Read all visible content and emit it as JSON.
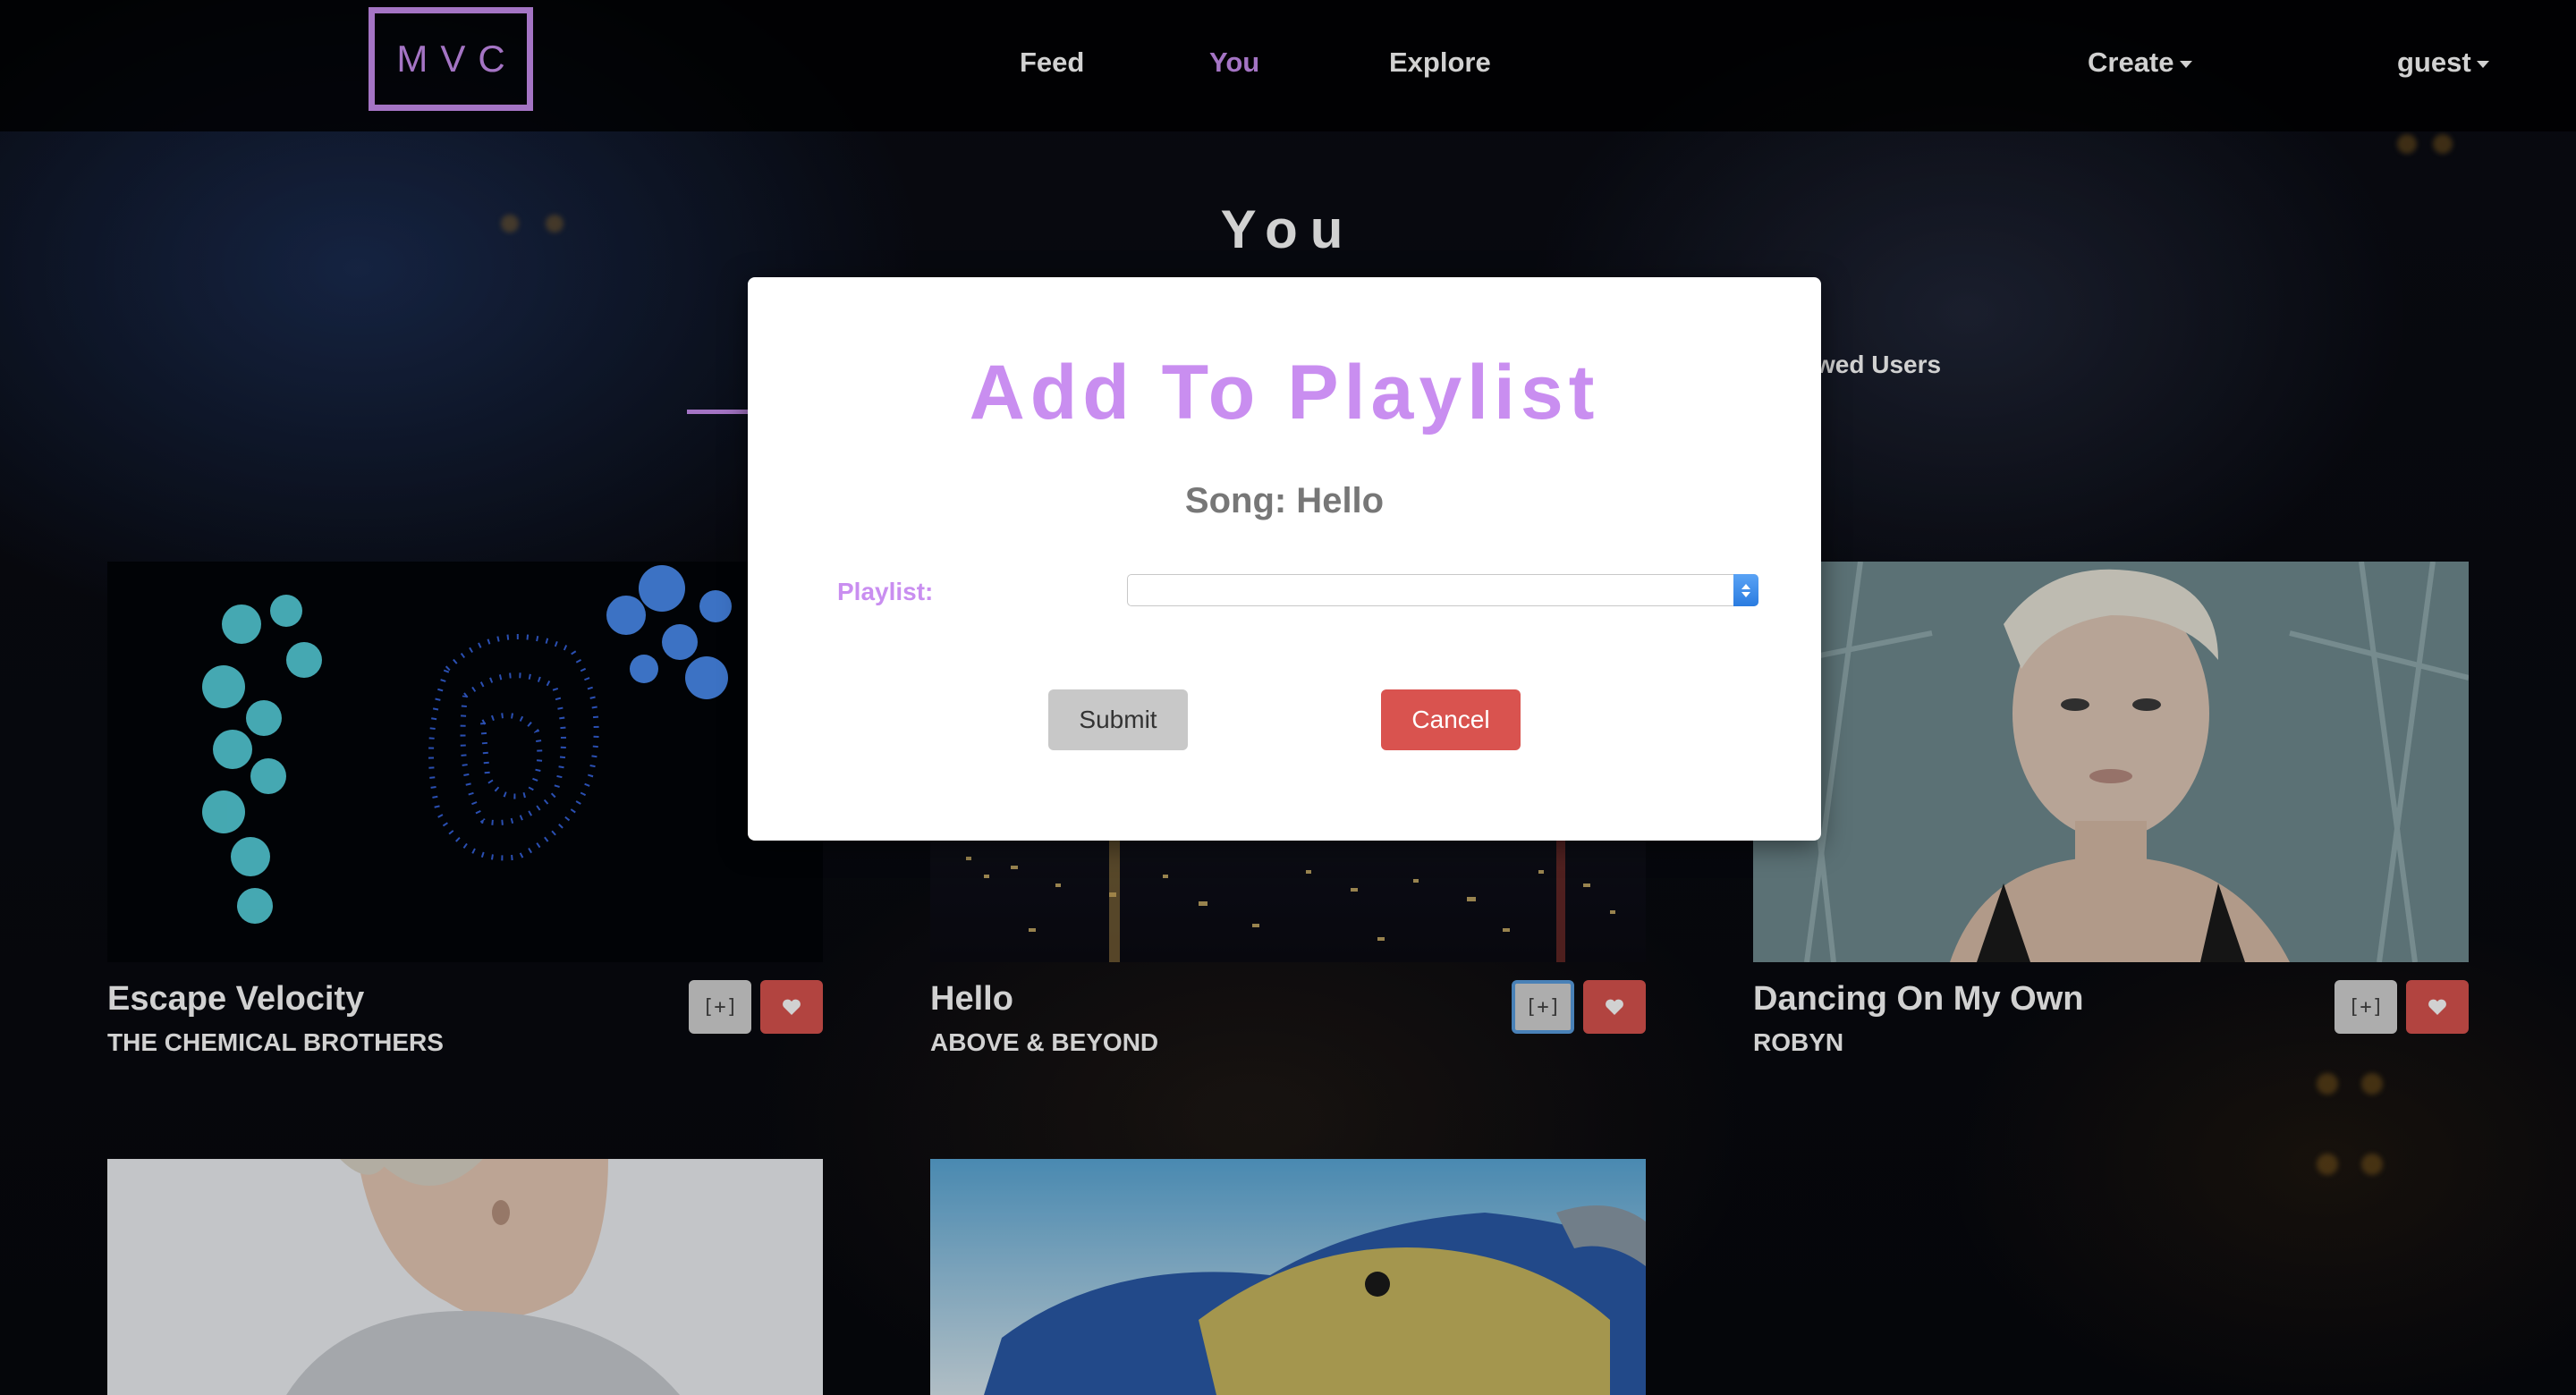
{
  "nav": {
    "logo": "MVC",
    "links": [
      "Feed",
      "You",
      "Explore"
    ],
    "active": "You",
    "create": "Create",
    "user": "guest"
  },
  "page": {
    "title": "You",
    "tab_fragment": "wed Users"
  },
  "songs": [
    {
      "title": "Escape Velocity",
      "artist": "THE CHEMICAL BROTHERS",
      "add_label": "[+]"
    },
    {
      "title": "Hello",
      "artist": "ABOVE & BEYOND",
      "add_label": "[+]"
    },
    {
      "title": "Dancing On My Own",
      "artist": "ROBYN",
      "add_label": "[+]"
    }
  ],
  "modal": {
    "title": "Add To Playlist",
    "song_line": "Song: Hello",
    "playlist_label": "Playlist:",
    "playlist_value": "",
    "submit": "Submit",
    "cancel": "Cancel"
  },
  "colors": {
    "accent": "#c98ef0",
    "danger": "#d9534f",
    "neutral_button": "#c8c8c8"
  }
}
